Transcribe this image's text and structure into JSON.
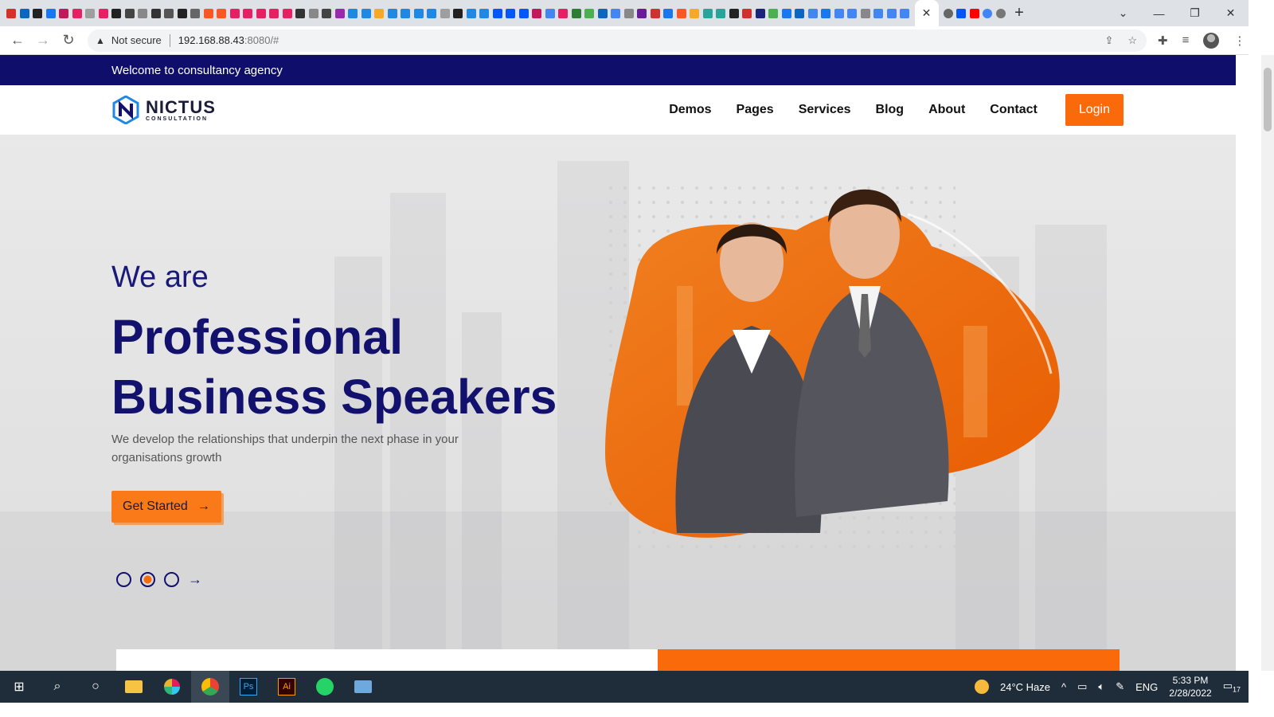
{
  "browser": {
    "active_tab_close": "✕",
    "new_tab": "+",
    "window_controls": [
      "⌄",
      "—",
      "❐",
      "✕"
    ],
    "security_label": "Not secure",
    "url_host": "192.168.88.43",
    "url_path": ":8080/#",
    "tab_favicon_colors": [
      "#d93025",
      "#0a66c2",
      "#222",
      "#1877f2",
      "#c2185b",
      "#e91e63",
      "#9e9e9e",
      "#e91e63",
      "#222",
      "#444",
      "#888",
      "#333",
      "#555",
      "#222",
      "#666",
      "#ff5722",
      "#ff5722",
      "#e91e63",
      "#e91e63",
      "#e91e63",
      "#e91e63",
      "#e91e63",
      "#333",
      "#888",
      "#444",
      "#9c27b0",
      "#1e88e5",
      "#1e88e5",
      "#f9a825",
      "#1e88e5",
      "#1e88e5",
      "#1e88e5",
      "#1e88e5",
      "#9e9e9e",
      "#222",
      "#1e88e5",
      "#1e88e5",
      "#0057ff",
      "#0057ff",
      "#0057ff",
      "#c2185b",
      "#4285f4",
      "#e91e63",
      "#2e7d32",
      "#4caf50",
      "#0a66c2",
      "#4285f4",
      "#888",
      "#6a1b9a",
      "#d32f2f",
      "#1877f2",
      "#ff5722",
      "#f9a825",
      "#26a69a",
      "#26a69a",
      "#222",
      "#d32f2f",
      "#1a237e",
      "#4caf50",
      "#1877f2",
      "#0a66c2",
      "#4285f4",
      "#1877f2",
      "#4285f4",
      "#4285f4",
      "#888",
      "#4285f4",
      "#4285f4",
      "#4285f4"
    ]
  },
  "site": {
    "topbar_text": "Welcome to consultancy agency",
    "logo_name": "NICTUS",
    "logo_tagline": "CONSULTATION",
    "nav": [
      "Demos",
      "Pages",
      "Services",
      "Blog",
      "About",
      "Contact"
    ],
    "login_label": "Login"
  },
  "hero": {
    "intro": "We are",
    "headline_line1": "Professional",
    "headline_line2": "Business Speakers",
    "subtitle": "We develop the relationships that underpin the next phase in your organisations growth",
    "cta_label": "Get Started",
    "cta_arrow": "→",
    "slider_next": "→",
    "active_slide": 2,
    "slide_count": 3
  },
  "colors": {
    "brand_navy": "#12126e",
    "accent_orange": "#fa6a0a"
  },
  "taskbar": {
    "weather": "24°C  Haze",
    "language": "ENG",
    "time": "5:33 PM",
    "date": "2/28/2022",
    "notifications": "17"
  }
}
